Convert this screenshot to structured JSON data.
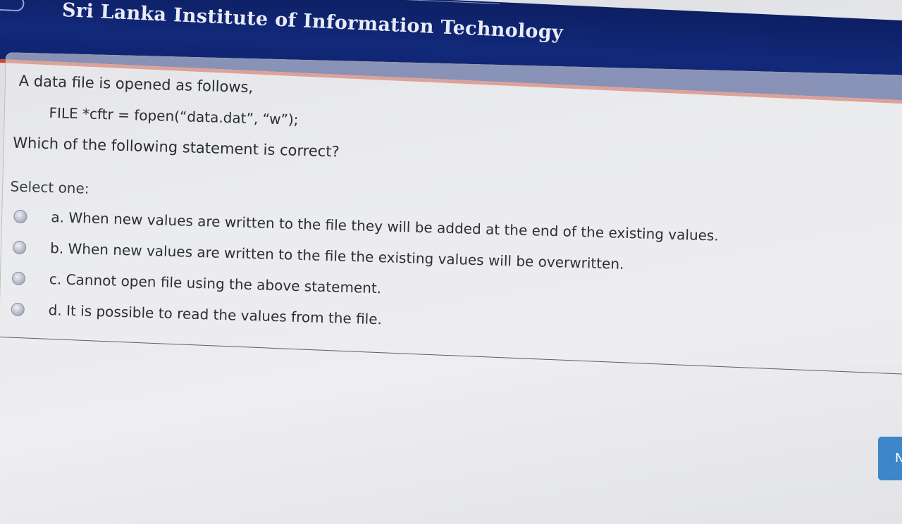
{
  "header": {
    "title": "Sri Lanka Institute of Information Technology",
    "logo_icon": "institute-logo-icon"
  },
  "question": {
    "line1": "A data file is opened as follows,",
    "code": "FILE *cftr = fopen(“data.dat”, “w”);",
    "line3": "Which of the following statement is correct?"
  },
  "select_prompt": "Select one:",
  "answers": [
    {
      "label": "a. When new values are written to the file they will be added at the end of the existing values."
    },
    {
      "label": "b. When new values are written to the file the existing values will be overwritten."
    },
    {
      "label": "c. Cannot open file using the above statement."
    },
    {
      "label": "d. It is possible to read the values from the file."
    }
  ],
  "next_button": {
    "label": "N"
  },
  "colors": {
    "header_bg": "#12297a",
    "header_accent": "#c8472d",
    "button_bg": "#3c86c9"
  }
}
